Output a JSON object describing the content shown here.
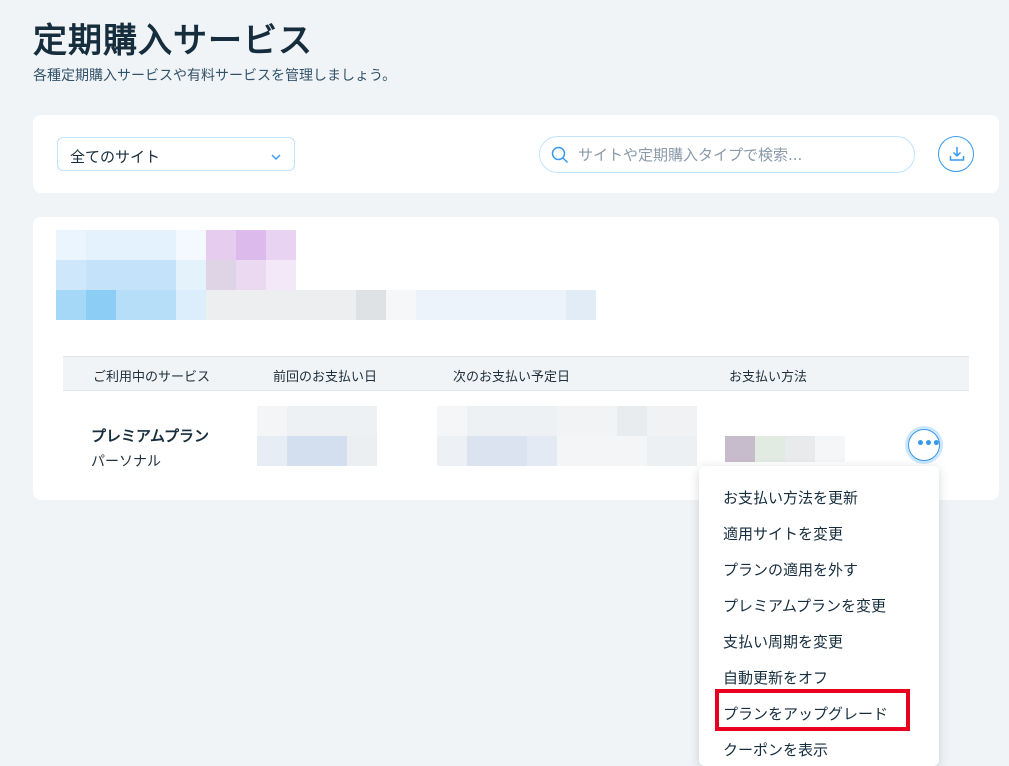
{
  "header": {
    "title": "定期購入サービス",
    "subtitle": "各種定期購入サービスや有料サービスを管理しましょう。"
  },
  "filters": {
    "site_select": {
      "selected": "全てのサイト"
    },
    "search": {
      "placeholder": "サイトや定期購入タイプで検索...",
      "value": ""
    },
    "download_icon": "download-icon"
  },
  "table": {
    "headers": [
      "ご利用中のサービス",
      "前回のお支払い日",
      "次のお支払い予定日",
      "お支払い方法"
    ],
    "rows": [
      {
        "service": "プレミアムプラン",
        "type": "パーソナル"
      }
    ]
  },
  "menu": {
    "items": [
      "お支払い方法を更新",
      "適用サイトを変更",
      "プランの適用を外す",
      "プレミアムプランを変更",
      "支払い周期を変更",
      "自動更新をオフ",
      "プランをアップグレード",
      "クーポンを表示"
    ],
    "highlighted": "プランをアップグレード"
  },
  "colors": {
    "accent": "#3899ec",
    "background": "#f0f4f7",
    "highlight": "#e8001e"
  }
}
